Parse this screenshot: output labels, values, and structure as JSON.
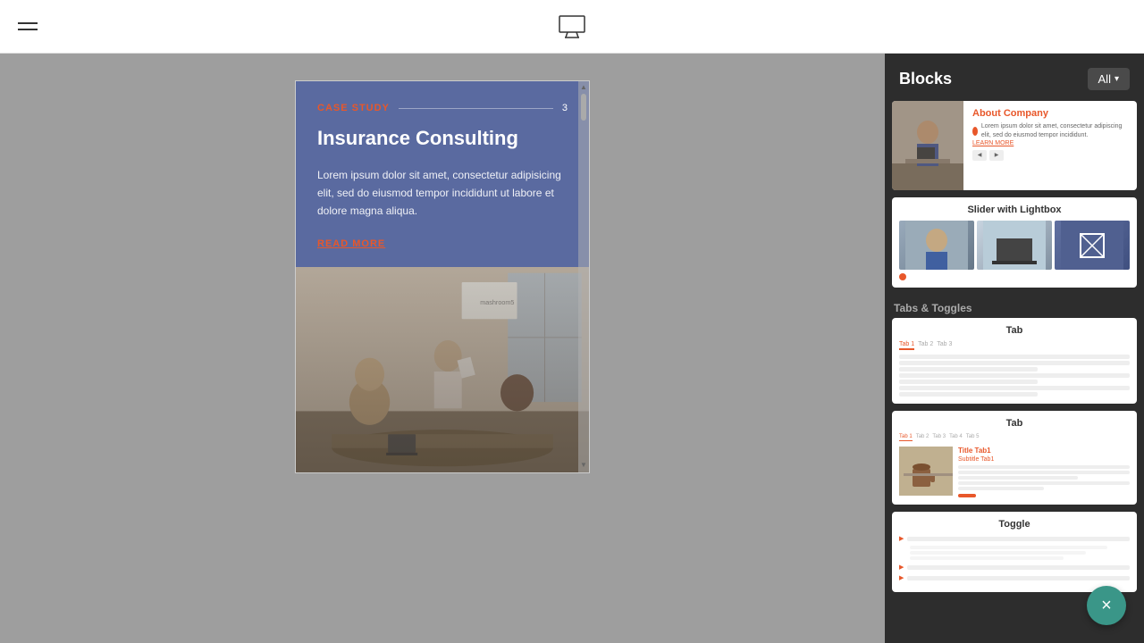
{
  "header": {
    "menu_icon_label": "menu",
    "monitor_icon_label": "monitor"
  },
  "canvas": {
    "case_study": {
      "label": "CASE STUDY",
      "number": "3",
      "title": "Insurance Consulting",
      "body": "Lorem ipsum dolor sit amet, consectetur adipisicing elit, sed do eiusmod tempor incididunt ut labore et dolore magna aliqua.",
      "read_more": "READ MORE"
    }
  },
  "right_panel": {
    "title": "Blocks",
    "all_button": "All",
    "blocks": [
      {
        "id": "about-company",
        "title": "About Company",
        "text": "Lorem ipsum dolor sit amet, consectetur adipiscing elit, sed do eiusmod tempor incididunt.",
        "link_text": "LEARN MORE"
      },
      {
        "id": "slider-lightbox",
        "title": "Slider with Lightbox"
      }
    ],
    "sections": [
      {
        "label": "Tabs & Toggles",
        "items": [
          {
            "id": "tab-1",
            "title": "Tab",
            "tabs": [
              "Tab 1",
              "Tab 2",
              "Tab 3"
            ]
          },
          {
            "id": "tab-2",
            "title": "Tab",
            "tabs": [
              "Tab 1",
              "Tab 2",
              "Tab 3",
              "Tab 4",
              "Tab 5"
            ],
            "content_title": "Title Tab1",
            "content_subtitle": "Subtitle Tab1"
          },
          {
            "id": "toggle-1",
            "title": "Toggle"
          }
        ]
      }
    ],
    "fab_icon": "×"
  }
}
